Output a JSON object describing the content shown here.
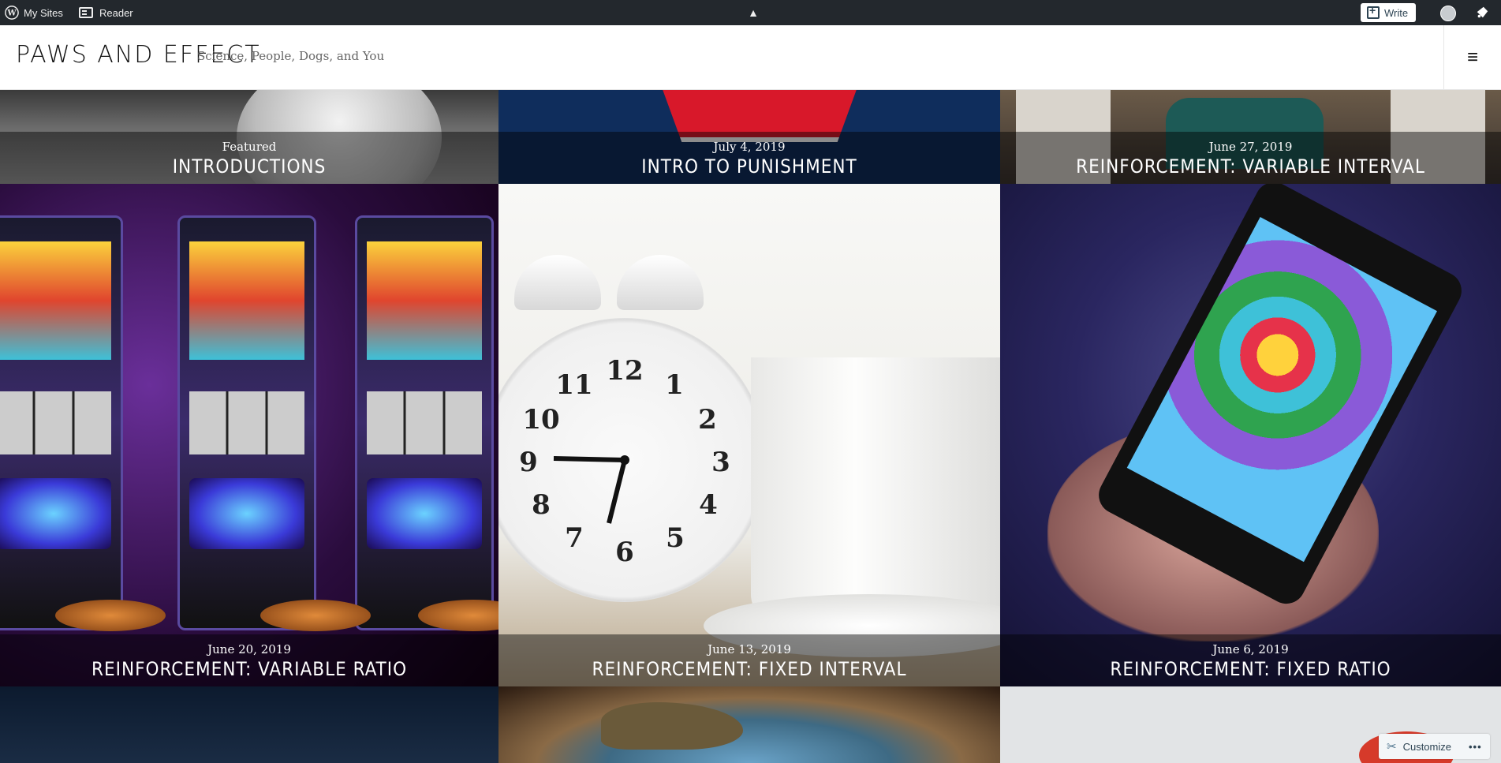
{
  "admin_bar": {
    "wp_logo": "wordpress-icon",
    "my_sites": "My Sites",
    "reader": "Reader",
    "collapse": "▲",
    "write": "Write"
  },
  "site": {
    "title": "PAWS AND EFFECT",
    "description": "Science, People, Dogs, and You",
    "menu_icon": "≡"
  },
  "posts": [
    {
      "date": "Featured",
      "title": "Introductions"
    },
    {
      "date": "July 4, 2019",
      "title": "Intro to Punishment"
    },
    {
      "date": "June 27, 2019",
      "title": "Reinforcement: Variable Interval"
    },
    {
      "date": "June 20, 2019",
      "title": "Reinforcement: Variable Ratio"
    },
    {
      "date": "June 13, 2019",
      "title": "Reinforcement: Fixed Interval"
    },
    {
      "date": "June 6, 2019",
      "title": "Reinforcement: Fixed Ratio"
    }
  ],
  "customize": {
    "label": "Customize",
    "more": "•••"
  }
}
